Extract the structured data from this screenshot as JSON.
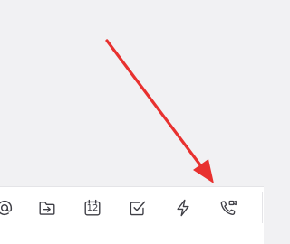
{
  "icon_color": "#3f3f46",
  "annotation_color": "#e8312f",
  "toolbar": {
    "items": [
      {
        "name": "mention-icon",
        "label": ""
      },
      {
        "name": "folder-move-icon",
        "label": ""
      },
      {
        "name": "calendar-icon",
        "label": "12"
      },
      {
        "name": "checkbox-icon",
        "label": ""
      },
      {
        "name": "lightning-icon",
        "label": ""
      },
      {
        "name": "phone-video-icon",
        "label": ""
      }
    ]
  }
}
